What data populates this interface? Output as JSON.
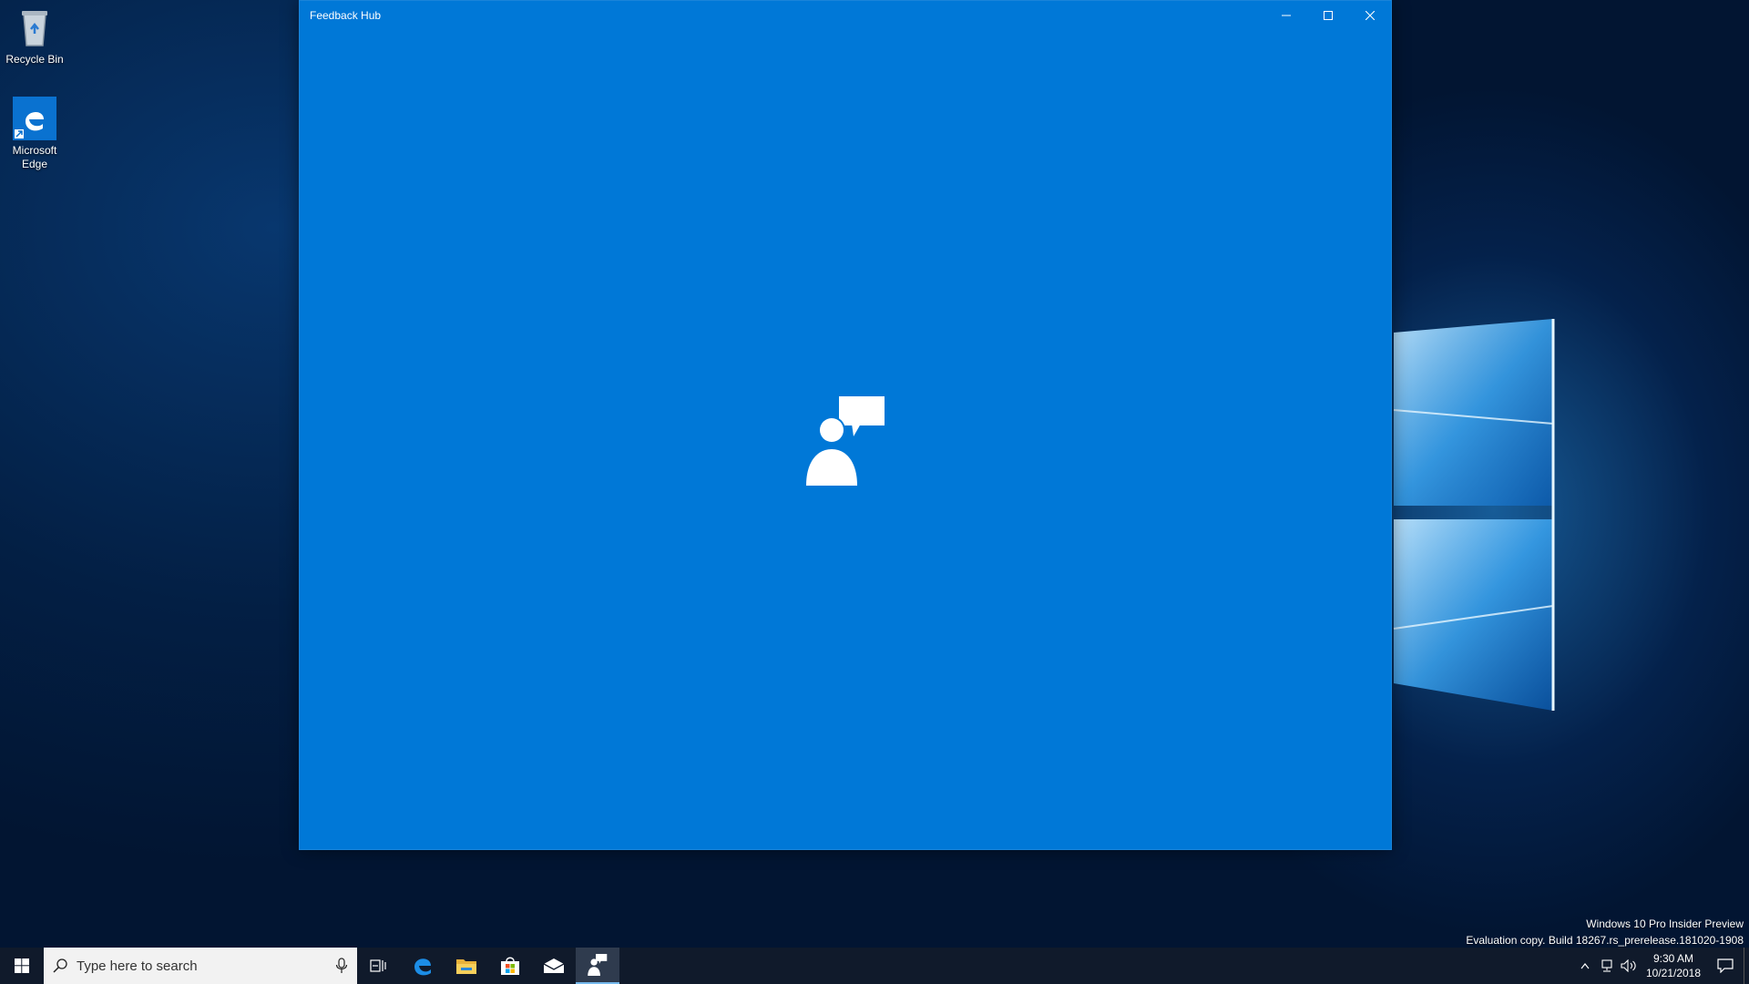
{
  "desktop": {
    "icons": [
      {
        "label": "Recycle Bin",
        "icon": "recycle-bin-icon"
      },
      {
        "label": "Microsoft Edge",
        "icon": "edge-icon"
      }
    ],
    "watermark": {
      "line1": "Windows 10 Pro Insider Preview",
      "line2": "Evaluation copy. Build 18267.rs_prerelease.181020-1908"
    }
  },
  "window": {
    "title": "Feedback Hub",
    "accent_color": "#0078d7",
    "splash_icon": "feedback-hub-icon",
    "caption_buttons": [
      "minimize",
      "maximize",
      "close"
    ]
  },
  "taskbar": {
    "background": "#101a2b",
    "search": {
      "placeholder": "Type here to search"
    },
    "apps": [
      {
        "name": "Task View",
        "icon": "task-view-icon"
      },
      {
        "name": "Microsoft Edge",
        "icon": "edge-icon"
      },
      {
        "name": "File Explorer",
        "icon": "file-explorer-icon"
      },
      {
        "name": "Microsoft Store",
        "icon": "store-icon"
      },
      {
        "name": "Mail",
        "icon": "mail-icon"
      },
      {
        "name": "Feedback Hub",
        "icon": "feedback-hub-icon",
        "active": true
      }
    ],
    "tray": {
      "time": "9:30 AM",
      "date": "10/21/2018"
    }
  }
}
